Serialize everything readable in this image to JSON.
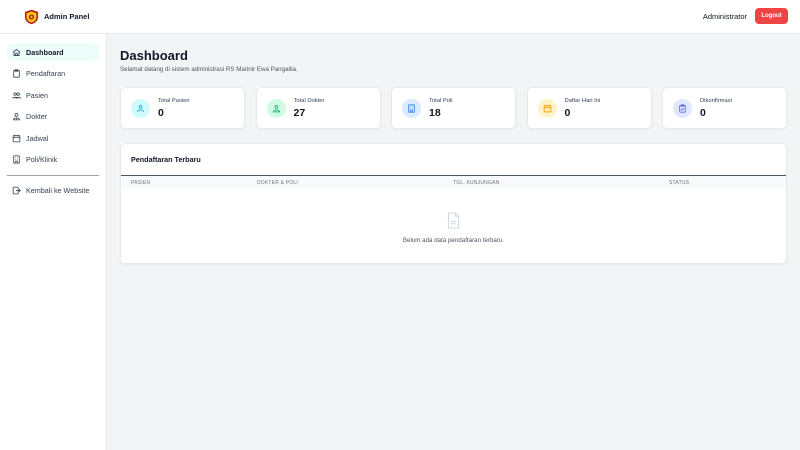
{
  "brand": {
    "name": "Admin Panel",
    "icon": "shield-emblem-icon"
  },
  "header": {
    "user": "Administrator",
    "logout_label": "Logout",
    "logout_color": "#ef4444"
  },
  "sidebar": {
    "items": [
      {
        "label": "Dashboard",
        "icon": "home-icon",
        "active": true
      },
      {
        "label": "Pendaftaran",
        "icon": "clipboard-icon"
      },
      {
        "label": "Pasien",
        "icon": "users-icon"
      },
      {
        "label": "Dokter",
        "icon": "user-doctor-icon"
      },
      {
        "label": "Jadwal",
        "icon": "calendar-icon"
      },
      {
        "label": "Poli/Klinik",
        "icon": "building-icon"
      }
    ],
    "back_link": {
      "label": "Kembali ke Website",
      "icon": "sign-out-icon"
    }
  },
  "page": {
    "title": "Dashboard",
    "subtitle": "Selamat datang di sistem administrasi RS Marinir Ewa Pangalila."
  },
  "stats": [
    {
      "label": "Total Pasien",
      "value": "0",
      "icon": "users-icon",
      "color": "#06b6d4",
      "bg": "#cffafe"
    },
    {
      "label": "Total Dokter",
      "value": "27",
      "icon": "user-doctor-icon",
      "color": "#10b981",
      "bg": "#d1fae5"
    },
    {
      "label": "Total Poli",
      "value": "18",
      "icon": "building-icon",
      "color": "#3b82f6",
      "bg": "#dbeafe"
    },
    {
      "label": "Daftar Hari Ini",
      "value": "0",
      "icon": "calendar-icon",
      "color": "#f59e0b",
      "bg": "#fef3c7"
    },
    {
      "label": "Dikonfirmasi",
      "value": "0",
      "icon": "clipboard-check-icon",
      "color": "#6366f1",
      "bg": "#e0e7ff"
    }
  ],
  "recent": {
    "title": "Pendaftaran Terbaru",
    "columns": [
      "PASIEN",
      "DOKTER & POLI",
      "TGL. KUNJUNGAN",
      "STATUS"
    ],
    "empty_text": "Belum ada data pendaftaran terbaru.",
    "empty_icon": "document-icon"
  },
  "colors": {
    "accent": "#14b8a6",
    "active_bg": "#ecfdfa",
    "background": "#f3f4f6"
  }
}
